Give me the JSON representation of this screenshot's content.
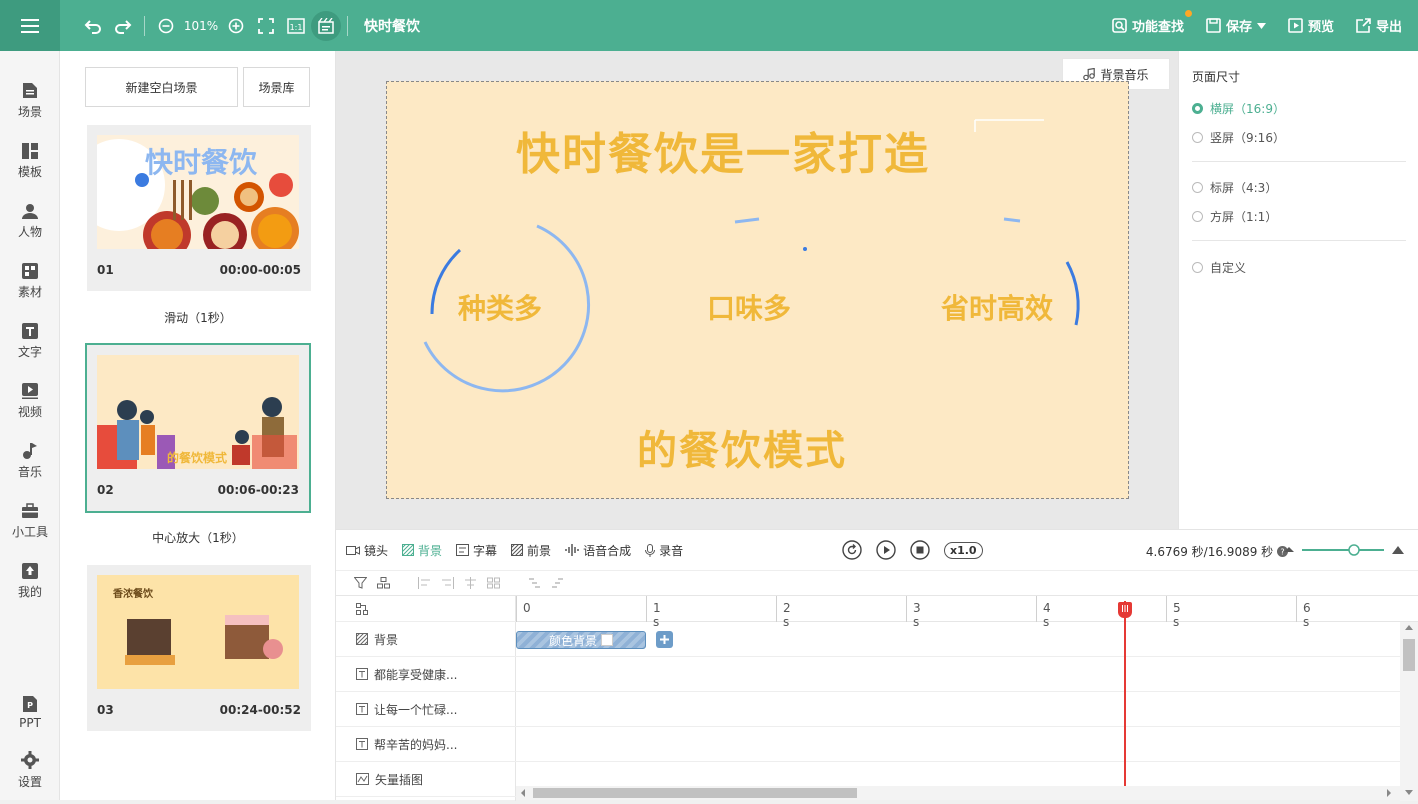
{
  "topbar": {
    "zoom": "101%",
    "project_title": "快时餐饮",
    "feature_search": "功能查找",
    "save": "保存",
    "preview": "预览",
    "export": "导出"
  },
  "nav": {
    "items": [
      {
        "label": "场景",
        "icon": "scene-icon"
      },
      {
        "label": "模板",
        "icon": "template-icon"
      },
      {
        "label": "人物",
        "icon": "person-icon"
      },
      {
        "label": "素材",
        "icon": "material-icon"
      },
      {
        "label": "文字",
        "icon": "text-icon"
      },
      {
        "label": "视频",
        "icon": "video-icon"
      },
      {
        "label": "音乐",
        "icon": "music-icon"
      },
      {
        "label": "小工具",
        "icon": "toolbox-icon"
      },
      {
        "label": "我的",
        "icon": "upload-icon"
      }
    ],
    "bottom": [
      {
        "label": "PPT",
        "icon": "ppt-icon"
      },
      {
        "label": "设置",
        "icon": "gear-icon"
      }
    ]
  },
  "scenes": {
    "new_blank": "新建空白场景",
    "library": "场景库",
    "list": [
      {
        "num": "01",
        "time": "00:00-00:05",
        "transition": "滑动（1秒）",
        "thumb_title": "快时餐饮"
      },
      {
        "num": "02",
        "time": "00:06-00:23",
        "transition": "中心放大（1秒）",
        "thumb_title": "的餐饮模式"
      },
      {
        "num": "03",
        "time": "00:24-00:52",
        "thumb_title": "香浓餐饮"
      }
    ]
  },
  "canvas": {
    "bg_music": "背景音乐",
    "headline": "快时餐饮是一家打造",
    "item1": "种类多",
    "item2": "口味多",
    "item3": "省时高效",
    "footer": "的餐饮模式"
  },
  "props": {
    "title": "页面尺寸",
    "options": [
      "横屏（16:9）",
      "竖屏（9:16）",
      "标屏（4:3）",
      "方屏（1:1）",
      "自定义"
    ],
    "selected_index": 0
  },
  "timeline": {
    "tabs": [
      "镜头",
      "背景",
      "字幕",
      "前景",
      "语音合成",
      "录音"
    ],
    "active_tab": 1,
    "speed": "x1.0",
    "time_info": "4.6769 秒/16.9089 秒",
    "ticks": [
      "0",
      "1 s",
      "2 s",
      "3 s",
      "4 s",
      "5 s",
      "6 s"
    ],
    "tracks": [
      {
        "label": "背景",
        "icon": "background-icon"
      },
      {
        "label": "都能享受健康...",
        "icon": "text-track-icon"
      },
      {
        "label": "让每一个忙碌...",
        "icon": "text-track-icon"
      },
      {
        "label": "帮辛苦的妈妈...",
        "icon": "text-track-icon"
      },
      {
        "label": "矢量插图",
        "icon": "vector-icon"
      }
    ],
    "clip_label": "颜色背景",
    "playhead_seconds": 4.6769,
    "total_seconds": 16.9089
  },
  "colors": {
    "brand": "#4caf91",
    "accent_text": "#f0b83a",
    "playhead": "#e53935"
  }
}
